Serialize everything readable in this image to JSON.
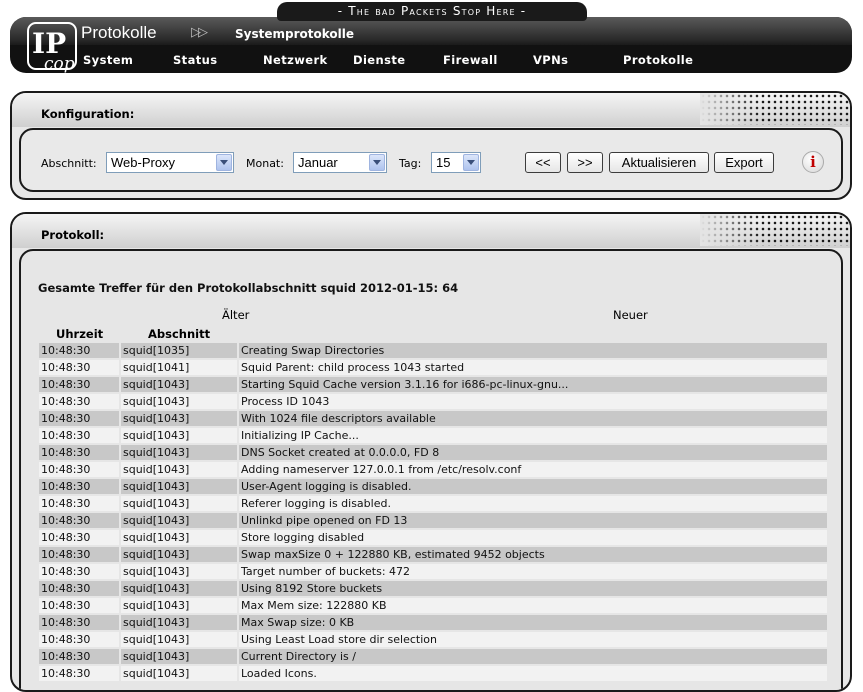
{
  "tagline": "- The bad Packets Stop Here -",
  "header": {
    "logo_text": "IPCop",
    "title": "Protokolle",
    "arrows": "▷▷",
    "subtitle": "Systemprotokolle",
    "nav": [
      "System",
      "Status",
      "Netzwerk",
      "Dienste",
      "Firewall",
      "VPNs",
      "Protokolle"
    ]
  },
  "konfiguration": {
    "title": "Konfiguration:",
    "section_label": "Abschnitt:",
    "section_value": "Web-Proxy",
    "month_label": "Monat:",
    "month_value": "Januar",
    "day_label": "Tag:",
    "day_value": "15",
    "prev_label": "<<",
    "next_label": ">>",
    "refresh_label": "Aktualisieren",
    "export_label": "Export",
    "info_glyph": "i"
  },
  "protokoll": {
    "title": "Protokoll:",
    "summary": "Gesamte Treffer für den Protokollabschnitt squid 2012-01-15: 64",
    "older": "Älter",
    "newer": "Neuer",
    "col_time": "Uhrzeit",
    "col_section": "Abschnitt",
    "rows": [
      {
        "time": "10:48:30",
        "section": "squid[1035]",
        "message": "Creating Swap Directories"
      },
      {
        "time": "10:48:30",
        "section": "squid[1041]",
        "message": "Squid Parent: child process 1043 started"
      },
      {
        "time": "10:48:30",
        "section": "squid[1043]",
        "message": "Starting Squid Cache version 3.1.16 for i686-pc-linux-gnu..."
      },
      {
        "time": "10:48:30",
        "section": "squid[1043]",
        "message": "Process ID 1043"
      },
      {
        "time": "10:48:30",
        "section": "squid[1043]",
        "message": "With 1024 file descriptors available"
      },
      {
        "time": "10:48:30",
        "section": "squid[1043]",
        "message": "Initializing IP Cache..."
      },
      {
        "time": "10:48:30",
        "section": "squid[1043]",
        "message": "DNS Socket created at 0.0.0.0, FD 8"
      },
      {
        "time": "10:48:30",
        "section": "squid[1043]",
        "message": "Adding nameserver 127.0.0.1 from /etc/resolv.conf"
      },
      {
        "time": "10:48:30",
        "section": "squid[1043]",
        "message": "User-Agent logging is disabled."
      },
      {
        "time": "10:48:30",
        "section": "squid[1043]",
        "message": "Referer logging is disabled."
      },
      {
        "time": "10:48:30",
        "section": "squid[1043]",
        "message": "Unlinkd pipe opened on FD 13"
      },
      {
        "time": "10:48:30",
        "section": "squid[1043]",
        "message": "Store logging disabled"
      },
      {
        "time": "10:48:30",
        "section": "squid[1043]",
        "message": "Swap maxSize 0 + 122880 KB, estimated 9452 objects"
      },
      {
        "time": "10:48:30",
        "section": "squid[1043]",
        "message": "Target number of buckets: 472"
      },
      {
        "time": "10:48:30",
        "section": "squid[1043]",
        "message": "Using 8192 Store buckets"
      },
      {
        "time": "10:48:30",
        "section": "squid[1043]",
        "message": "Max Mem size: 122880 KB"
      },
      {
        "time": "10:48:30",
        "section": "squid[1043]",
        "message": "Max Swap size: 0 KB"
      },
      {
        "time": "10:48:30",
        "section": "squid[1043]",
        "message": "Using Least Load store dir selection"
      },
      {
        "time": "10:48:30",
        "section": "squid[1043]",
        "message": "Current Directory is /"
      },
      {
        "time": "10:48:30",
        "section": "squid[1043]",
        "message": "Loaded Icons."
      }
    ]
  }
}
